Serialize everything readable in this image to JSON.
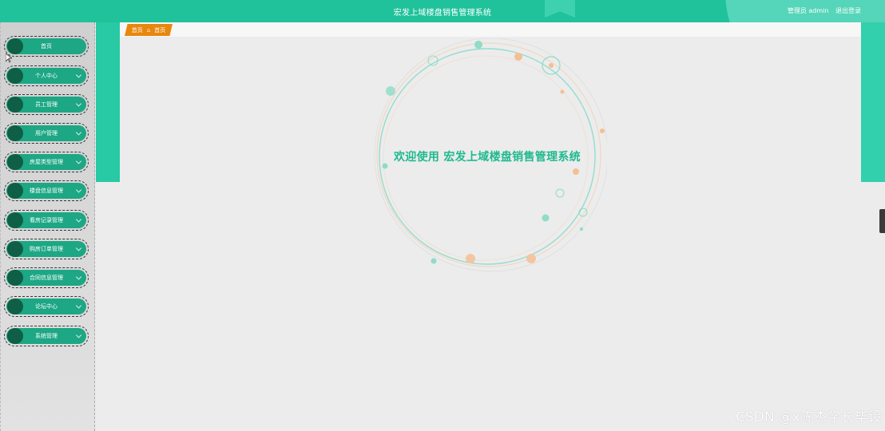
{
  "header": {
    "title": "宏发上域楼盘销售管理系统",
    "user_label": "管理员 admin",
    "logout_label": "退出登录"
  },
  "breadcrumb": {
    "root": "首页",
    "separator": "⌂",
    "current": "首页"
  },
  "sidebar": {
    "items": [
      {
        "label": "首页",
        "has_arrow": false
      },
      {
        "label": "个人中心",
        "has_arrow": true
      },
      {
        "label": "员工管理",
        "has_arrow": true
      },
      {
        "label": "用户管理",
        "has_arrow": true
      },
      {
        "label": "房屋类型管理",
        "has_arrow": true
      },
      {
        "label": "楼盘信息管理",
        "has_arrow": true
      },
      {
        "label": "看房记录管理",
        "has_arrow": true
      },
      {
        "label": "购房订单管理",
        "has_arrow": true
      },
      {
        "label": "合同信息管理",
        "has_arrow": true
      },
      {
        "label": "论坛中心",
        "has_arrow": true
      },
      {
        "label": "系统管理",
        "has_arrow": true
      }
    ]
  },
  "main": {
    "welcome_text": "欢迎使用 宏发上域楼盘销售管理系统"
  },
  "watermark": "CSDN @x陈杰学长毕设",
  "colors": {
    "header": "#1fc29a",
    "menu_pill": "#1da784",
    "menu_dot": "#0f5e46",
    "breadcrumb": "#e8870e",
    "welcome_text": "#1fb98f"
  }
}
